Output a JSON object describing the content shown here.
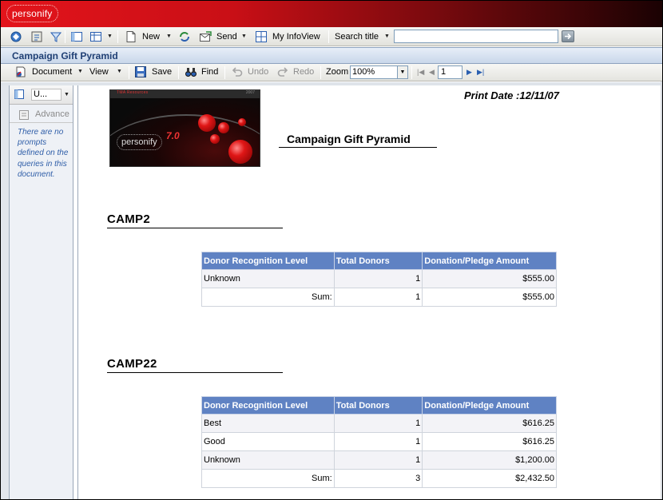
{
  "app": {
    "logo_text": "personify"
  },
  "toolbar1": {
    "new_label": "New",
    "send_label": "Send",
    "my_infoview_label": "My InfoView",
    "search_title_label": "Search title",
    "search_value": ""
  },
  "document": {
    "title": "Campaign Gift Pyramid"
  },
  "toolbar2": {
    "document_label": "Document",
    "view_label": "View",
    "save_label": "Save",
    "find_label": "Find",
    "undo_label": "Undo",
    "redo_label": "Redo",
    "zoom_label": "Zoom",
    "zoom_value": "100%",
    "page_value": "1"
  },
  "left_panel": {
    "selector_value": "U...",
    "advanced_label": "Advance",
    "message": "There are no prompts defined on the queries in this document."
  },
  "report": {
    "print_date": "Print Date :12/11/07",
    "title": "Campaign Gift Pyramid",
    "banner": {
      "strip_text": "TMA Resources",
      "strip_num": "2007",
      "logo_text": "personify",
      "version": "7.0"
    },
    "columns": [
      "Donor Recognition Level",
      "Total Donors",
      "Donation/Pledge Amount"
    ],
    "sections": [
      {
        "name": "CAMP2",
        "rows": [
          {
            "level": "Unknown",
            "donors": "1",
            "amount": "$555.00"
          }
        ],
        "sum": {
          "label": "Sum:",
          "donors": "1",
          "amount": "$555.00"
        }
      },
      {
        "name": "CAMP22",
        "rows": [
          {
            "level": "Best",
            "donors": "1",
            "amount": "$616.25"
          },
          {
            "level": "Good",
            "donors": "1",
            "amount": "$616.25"
          },
          {
            "level": "Unknown",
            "donors": "1",
            "amount": "$1,200.00"
          }
        ],
        "sum": {
          "label": "Sum:",
          "donors": "3",
          "amount": "$2,432.50"
        }
      }
    ]
  },
  "colors": {
    "header_red": "#e3141b",
    "table_header_blue": "#5f82c3",
    "title_blue": "#1f3f74",
    "prompt_text_blue": "#2f5ea8"
  }
}
